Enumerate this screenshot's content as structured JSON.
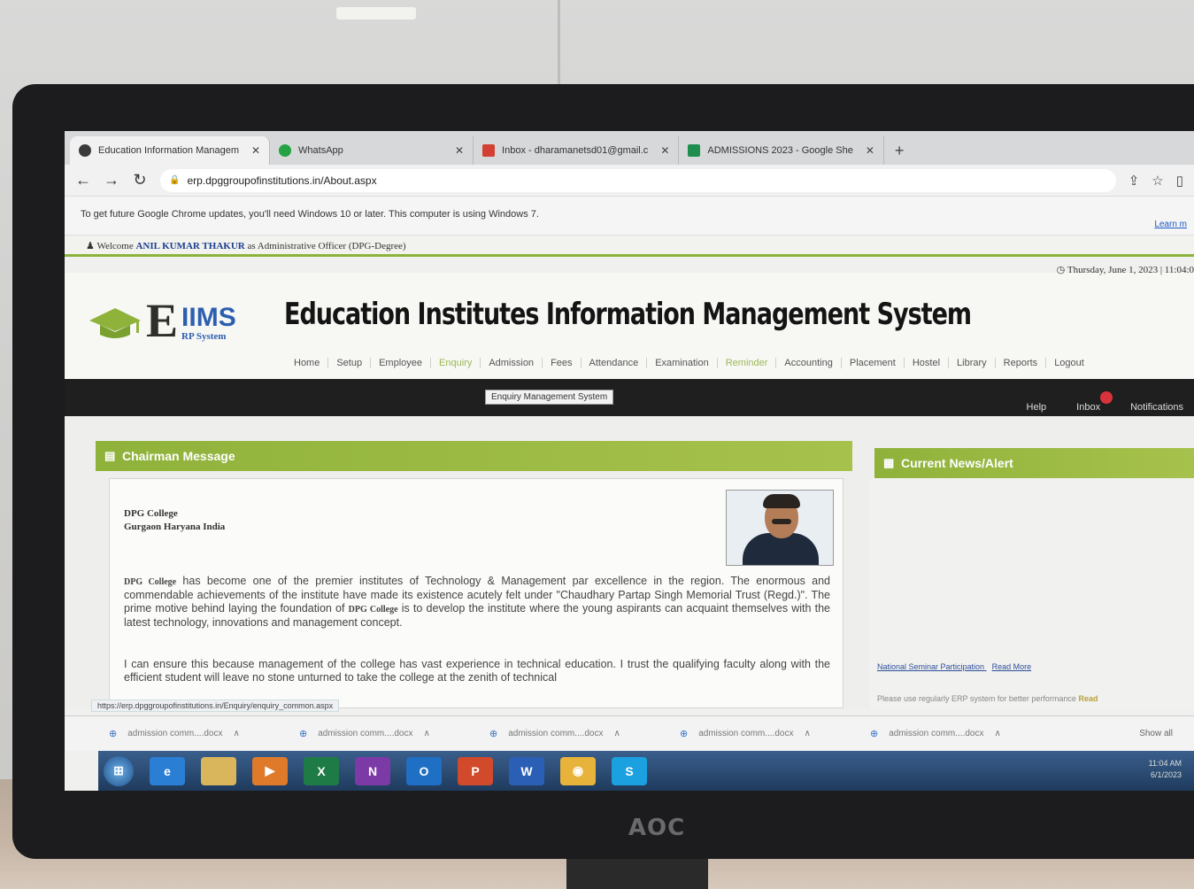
{
  "browser": {
    "tabs": [
      {
        "label": "Education Information Managem",
        "color": "#3b3b3b"
      },
      {
        "label": "WhatsApp",
        "color": "#25a244"
      },
      {
        "label": "Inbox - dharamanetsd01@gmail.c",
        "color": "#d24133"
      },
      {
        "label": "ADMISSIONS 2023 - Google She",
        "color": "#1e8e4e"
      }
    ],
    "url": "erp.dpggroupofinstitutions.in/About.aspx",
    "infobar_text": "To get future Google Chrome updates, you'll need Windows 10 or later. This computer is using Windows 7.",
    "infobar_link": "Learn m",
    "status_url": "https://erp.dpggroupofinstitutions.in/Enquiry/enquiry_common.aspx"
  },
  "site": {
    "welcome_prefix": "Welcome",
    "user_name": "ANIL KUMAR THAKUR",
    "welcome_suffix": "as Administrative Officer (DPG-Degree)",
    "datetime": "Thursday, June 1, 2023 | 11:04:0",
    "logo_e": "E",
    "logo_iims": "IIMS",
    "logo_sub": "RP System",
    "title": "Education Institutes Information Management System",
    "menu": [
      "Home",
      "Setup",
      "Employee",
      "Enquiry",
      "Admission",
      "Fees",
      "Attendance",
      "Examination",
      "Reminder",
      "Accounting",
      "Placement",
      "Hostel",
      "Library",
      "Reports",
      "Logout"
    ],
    "tooltip": "Enquiry Management System",
    "right_menu": [
      "Help",
      "Inbox",
      "Notifications"
    ]
  },
  "chairman": {
    "heading": "Chairman Message",
    "college_name": "DPG College",
    "college_location": "Gurgaon Haryana India",
    "para1_lead": "DPG College",
    "para1_a": " has become one of the premier institutes of Technology & Management par excellence in the region. The enormous and commendable achievements of the institute have made its existence acutely felt under \"Chaudhary Partap Singh Memorial Trust (Regd.)\". The prime motive behind laying the foundation of ",
    "para1_mid": "DPG College",
    "para1_b": " is to develop the institute where the young aspirants can acquaint themselves with the latest technology, innovations and management concept.",
    "para2": "I can ensure this because management of the college has vast experience in technical education. I trust the qualifying faculty along with the efficient student will leave no stone unturned to take the college at the zenith of technical"
  },
  "news": {
    "heading": "Current News/Alert",
    "item1": "National Seminar Participation",
    "item1_more": "Read More",
    "item2": "Please use regularly ERP system for better performance",
    "item2_more": "Read"
  },
  "downloads": {
    "items": [
      "admission comm....docx",
      "admission comm....docx",
      "admission comm....docx",
      "admission comm....docx",
      "admission comm....docx"
    ],
    "show_all": "Show all"
  },
  "taskbar": {
    "apps": [
      {
        "name": "ie",
        "color": "#2a7fd4",
        "glyph": "e"
      },
      {
        "name": "explorer",
        "color": "#d9b65c",
        "glyph": ""
      },
      {
        "name": "media",
        "color": "#e07a2b",
        "glyph": "▶"
      },
      {
        "name": "excel",
        "color": "#1e7b45",
        "glyph": "X"
      },
      {
        "name": "onenote",
        "color": "#7b3aa6",
        "glyph": "N"
      },
      {
        "name": "outlook",
        "color": "#1f6fc4",
        "glyph": "O"
      },
      {
        "name": "powerpoint",
        "color": "#d04a2b",
        "glyph": "P"
      },
      {
        "name": "word",
        "color": "#2b5fb5",
        "glyph": "W"
      },
      {
        "name": "chrome",
        "color": "#e8b33a",
        "glyph": "◉"
      },
      {
        "name": "skype",
        "color": "#1ba0e0",
        "glyph": "S"
      }
    ],
    "time": "11:04 AM",
    "date": "6/1/2023"
  },
  "monitor_brand": "AOC",
  "colors": {
    "accent_green": "#8fb23b",
    "dark_nav": "#1f1f1f",
    "link_blue": "#2d5fb0"
  }
}
